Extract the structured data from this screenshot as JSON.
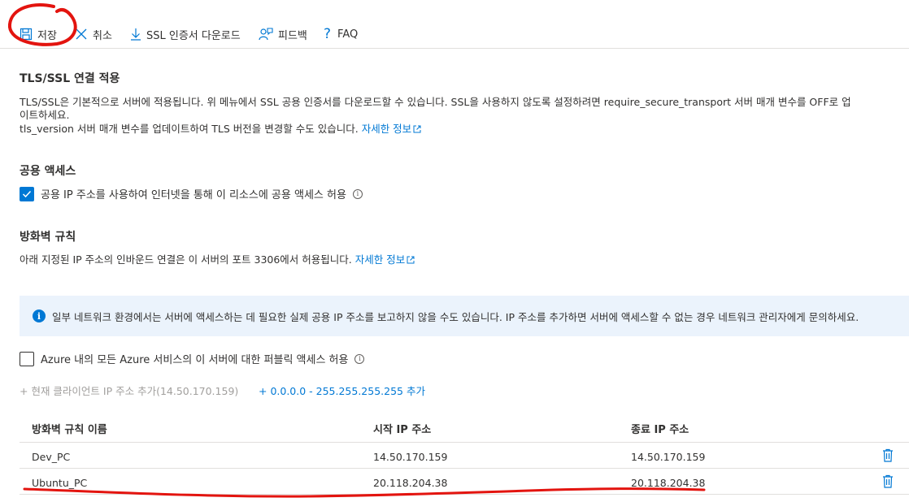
{
  "toolbar": {
    "save": {
      "label": "저장",
      "icon": "save-icon"
    },
    "cancel": {
      "label": "취소",
      "icon": "close-icon"
    },
    "ssl_download": {
      "label": "SSL 인증서 다운로드",
      "icon": "download-icon"
    },
    "feedback": {
      "label": "피드백",
      "icon": "feedback-icon"
    },
    "faq": {
      "label": "FAQ",
      "icon": "question-icon"
    }
  },
  "tls": {
    "title": "TLS/SSL 연결 적용",
    "line1": "TLS/SSL은 기본적으로 서버에 적용됩니다. 위 메뉴에서 SSL 공용 인증서를 다운로드할 수 있습니다. SSL을 사용하지 않도록 설정하려면 require_secure_transport 서버 매개 변수를 OFF로 업",
    "line2": "이트하세요.",
    "line3": "tls_version 서버 매개 변수를 업데이트하여 TLS 버전을 변경할 수도 있습니다.",
    "link": "자세한 정보"
  },
  "public_access": {
    "title": "공용 액세스",
    "checkbox_label": "공용 IP 주소를 사용하여 인터넷을 통해 이 리소스에 공용 액세스 허용",
    "checked": true
  },
  "firewall": {
    "title": "방화벽 규칙",
    "desc": "아래 지정된 IP 주소의 인바운드 연결은 이 서버의 포트 3306에서 허용됩니다.",
    "link": "자세한 정보",
    "banner": "일부 네트워크 환경에서는 서버에 액세스하는 데 필요한 실제 공용 IP 주소를 보고하지 않을 수도 있습니다. IP 주소를 추가하면 서버에 액세스할 수 없는 경우 네트워크 관리자에게 문의하세요.",
    "azure_checkbox_label": "Azure 내의 모든 Azure 서비스의 이 서버에 대한 퍼블릭 액세스 허용",
    "azure_checked": false,
    "add_client_ip": "+ 현재 클라이언트 IP 주소 추가(14.50.170.159)",
    "add_range": "+ 0.0.0.0 - 255.255.255.255 추가"
  },
  "table": {
    "headers": [
      "방화벽 규칙 이름",
      "시작 IP 주소",
      "종료 IP 주소"
    ],
    "rows": [
      {
        "name": "Dev_PC",
        "start": "14.50.170.159",
        "end": "14.50.170.159"
      },
      {
        "name": "Ubuntu_PC",
        "start": "20.118.204.38",
        "end": "20.118.204.38"
      }
    ]
  },
  "colors": {
    "accent": "#0078d4",
    "annotation": "#e3140f",
    "banner_bg": "#ebf3fc"
  }
}
